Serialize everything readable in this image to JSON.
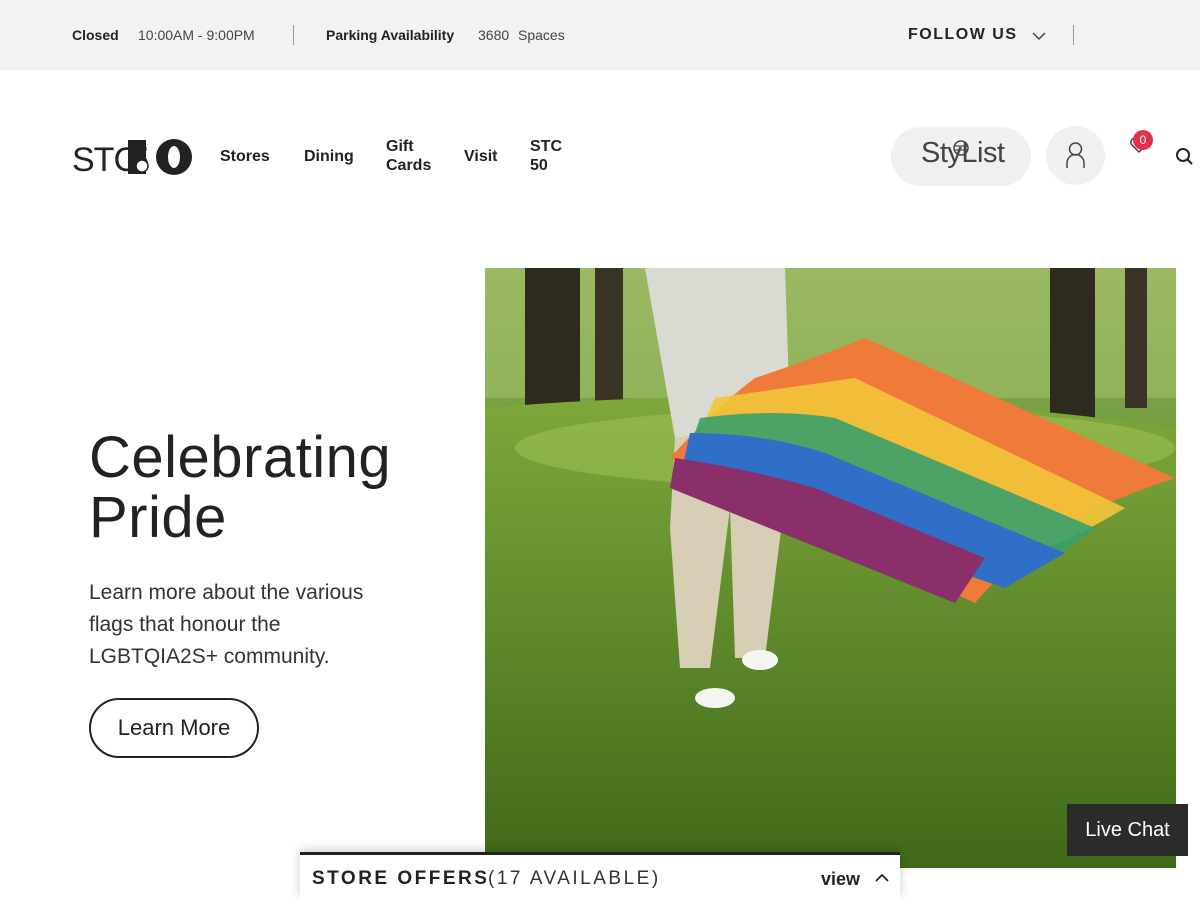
{
  "topbar": {
    "status": "Closed",
    "hours": "10:00AM - 9:00PM",
    "parking_label": "Parking Availability",
    "parking_count": "3680",
    "parking_unit": "Spaces",
    "follow_label": "FOLLOW US"
  },
  "header": {
    "logo_text": "STC50",
    "nav": [
      "Stores",
      "Dining",
      "Gift Cards",
      "Visit",
      "STC 50"
    ],
    "stylist_label": "StyList",
    "wishlist_count": "0"
  },
  "hero": {
    "title": "Celebrating Pride",
    "subtitle": "Learn more about the various flags that honour the LGBTQIA2S+ community.",
    "cta": "Learn More"
  },
  "live_chat": "Live Chat",
  "offers": {
    "title": "STORE OFFERS",
    "count": "(17 AVAILABLE)",
    "view_label": "view"
  },
  "colors": {
    "topbar_bg": "#f2f2f2",
    "badge": "#e0324a",
    "live_chat_bg": "#2b2b2b"
  },
  "icons": [
    "chevron-down-icon",
    "user-icon",
    "heart-icon",
    "search-icon",
    "chevron-up-icon"
  ]
}
